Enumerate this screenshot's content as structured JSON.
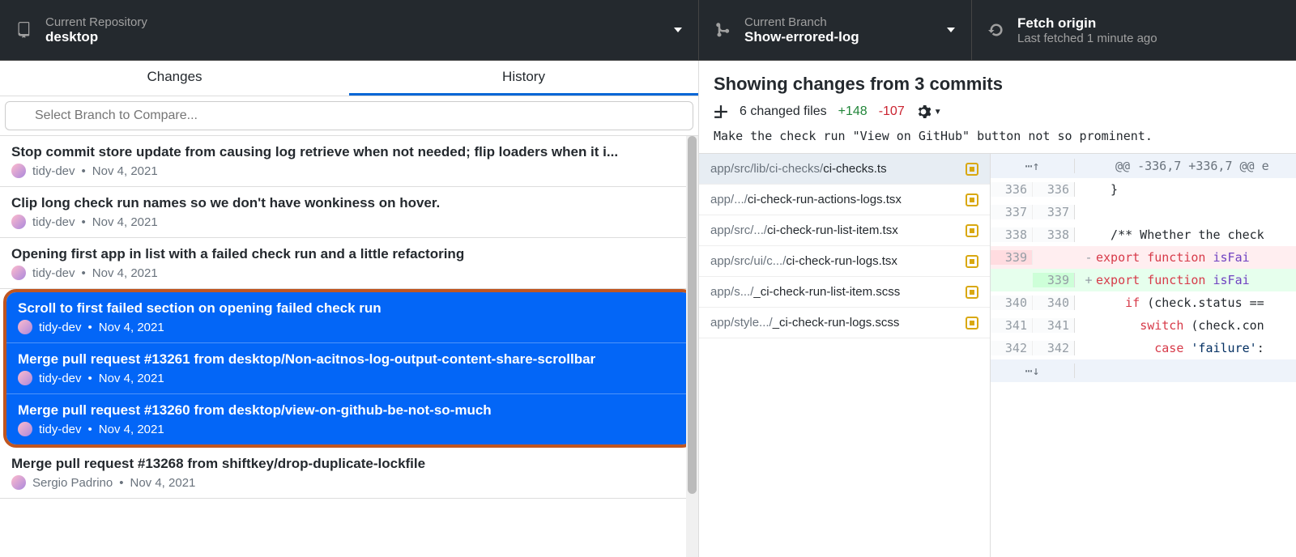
{
  "toolbar": {
    "repo_label": "Current Repository",
    "repo_value": "desktop",
    "branch_label": "Current Branch",
    "branch_value": "Show-errored-log",
    "fetch_label": "Fetch origin",
    "fetch_sub": "Last fetched 1 minute ago"
  },
  "tabs": {
    "changes": "Changes",
    "history": "History"
  },
  "compare_placeholder": "Select Branch to Compare...",
  "commits": [
    {
      "title": "Stop commit store update from causing log retrieve when not needed; flip loaders when it i...",
      "author": "tidy-dev",
      "date": "Nov 4, 2021"
    },
    {
      "title": "Clip long check run names so we don't have wonkiness on hover.",
      "author": "tidy-dev",
      "date": "Nov 4, 2021"
    },
    {
      "title": "Opening first app in list with a failed check run and a little refactoring",
      "author": "tidy-dev",
      "date": "Nov 4, 2021"
    }
  ],
  "selected_commits": [
    {
      "title": "Scroll to first failed section on opening failed check run",
      "author": "tidy-dev",
      "date": "Nov 4, 2021"
    },
    {
      "title": "Merge pull request #13261 from desktop/Non-acitnos-log-output-content-share-scrollbar",
      "author": "tidy-dev",
      "date": "Nov 4, 2021"
    },
    {
      "title": "Merge pull request #13260 from desktop/view-on-github-be-not-so-much",
      "author": "tidy-dev",
      "date": "Nov 4, 2021"
    }
  ],
  "commits_after": [
    {
      "title": "Merge pull request #13268 from shiftkey/drop-duplicate-lockfile",
      "author": "Sergio Padrino",
      "date": "Nov 4, 2021"
    }
  ],
  "right": {
    "title": "Showing changes from 3 commits",
    "files_count": "6 changed files",
    "additions": "+148",
    "deletions": "-107",
    "message": "Make the check run \"View on GitHub\" button not so prominent."
  },
  "files": [
    {
      "dim": "app/src/lib/ci-checks/",
      "name": "ci-checks.ts",
      "active": true
    },
    {
      "dim": "app/.../",
      "name": "ci-check-run-actions-logs.tsx"
    },
    {
      "dim": "app/src/.../",
      "name": "ci-check-run-list-item.tsx"
    },
    {
      "dim": "app/src/ui/c.../",
      "name": "ci-check-run-logs.tsx"
    },
    {
      "dim": "app/s.../",
      "name": "_ci-check-run-list-item.scss"
    },
    {
      "dim": "app/style.../",
      "name": "_ci-check-run-logs.scss"
    }
  ],
  "hunk_header": "@@ -336,7 +336,7 @@ e",
  "diff_lines": [
    {
      "a": "336",
      "b": "336",
      "type": "ctx",
      "html": "  }"
    },
    {
      "a": "337",
      "b": "337",
      "type": "ctx",
      "html": ""
    },
    {
      "a": "338",
      "b": "338",
      "type": "ctx",
      "html": "  /** Whether the check"
    },
    {
      "a": "339",
      "b": "",
      "type": "del",
      "html": "<span class='tok-kw'>export</span> <span class='tok-kw'>function</span> <span class='tok-fn'>isFai</span>"
    },
    {
      "a": "",
      "b": "339",
      "type": "add",
      "html": "<span class='tok-kw'>export</span> <span class='tok-kw'>function</span> <span class='tok-fn'>isFai</span>"
    },
    {
      "a": "340",
      "b": "340",
      "type": "ctx",
      "html": "    <span class='tok-kw'>if</span> (check.status =="
    },
    {
      "a": "341",
      "b": "341",
      "type": "ctx",
      "html": "      <span class='tok-kw'>switch</span> (check.con"
    },
    {
      "a": "342",
      "b": "342",
      "type": "ctx",
      "html": "        <span class='tok-kw'>case</span> <span class='tok-str'>'failure'</span>:"
    }
  ]
}
